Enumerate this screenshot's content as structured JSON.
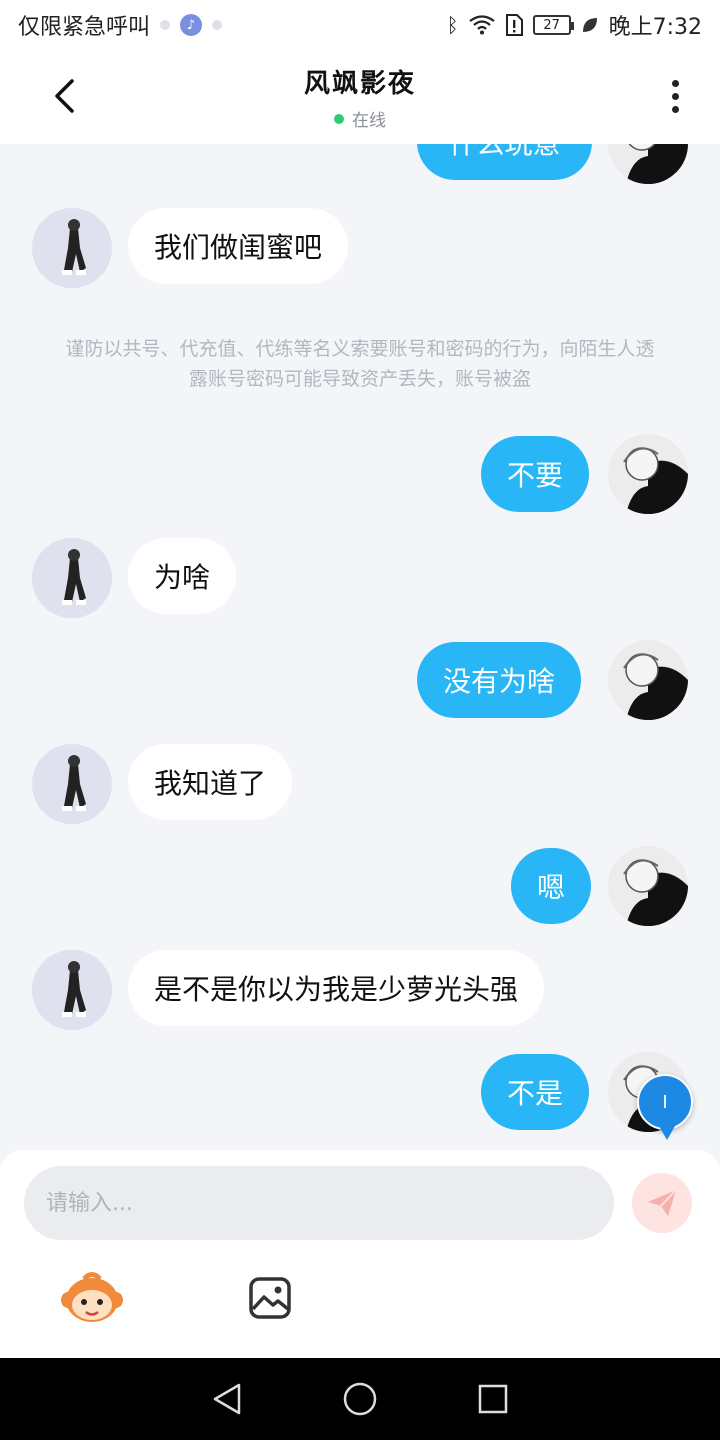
{
  "status_bar": {
    "carrier_text": "仅限紧急呼叫",
    "battery": "27",
    "time": "晚上7:32"
  },
  "header": {
    "title": "风飒影夜",
    "status": "在线"
  },
  "messages": [
    {
      "from": "me",
      "text": "什么玩意"
    },
    {
      "from": "other",
      "text": "我们做闺蜜吧"
    },
    {
      "from": "system",
      "text": "谨防以共号、代充值、代练等名义索要账号和密码的行为，向陌生人透露账号密码可能导致资产丢失，账号被盗"
    },
    {
      "from": "me",
      "text": "不要"
    },
    {
      "from": "other",
      "text": "为啥"
    },
    {
      "from": "me",
      "text": "没有为啥"
    },
    {
      "from": "other",
      "text": "我知道了"
    },
    {
      "from": "me",
      "text": "嗯"
    },
    {
      "from": "other",
      "text": "是不是你以为我是少萝光头强"
    },
    {
      "from": "me",
      "text": "不是"
    }
  ],
  "floating_badge": "I",
  "composer": {
    "placeholder": "请输入..."
  },
  "colors": {
    "my_bubble": "#29b6f6",
    "other_bubble": "#ffffff",
    "background": "#f3f5f9",
    "online_dot": "#2ecc71",
    "send_button": "#fde3e1"
  }
}
